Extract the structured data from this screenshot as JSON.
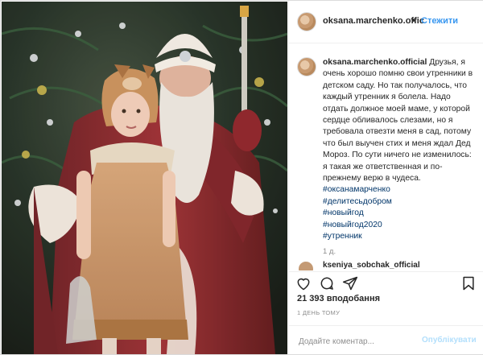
{
  "post": {
    "username": "oksana.marchenko.offic",
    "separator": "•",
    "follow_label": "Стежити"
  },
  "caption": {
    "username": "oksana.marchenko.official",
    "text": "Друзья, я очень хорошо помню свои утренники в детском саду. Но так получалось, что каждый утренник я болела. Надо отдать должное моей маме, у которой сердце обливалось слезами, но я требовала отвезти меня в сад, потому что был выучен стих и меня ждал Дед Мороз. По сути ничего не изменилось: я такая же ответственная и по-прежнему верю в чудеса.",
    "hashtags": [
      "#оксанамарченко",
      "#делитесьдобром",
      "#новыйгод",
      "#новыйгод2020",
      "#утренник"
    ],
    "time": "1 д."
  },
  "second_comment": {
    "username": "kseniya_sobchak_official"
  },
  "likes": "21 393 вподобання",
  "posted_ago": "1 ДЕНЬ ТОМУ",
  "comment_box": {
    "placeholder": "Додайте коментар...",
    "publish_label": "Опублікувати"
  },
  "colors": {
    "link": "#3897f0",
    "hashtag": "#003569",
    "publish_disabled": "#b2dffc",
    "text": "#262626",
    "muted": "#8e8e8e"
  },
  "icons": [
    "heart-icon",
    "comment-icon",
    "share-icon",
    "bookmark-icon"
  ]
}
